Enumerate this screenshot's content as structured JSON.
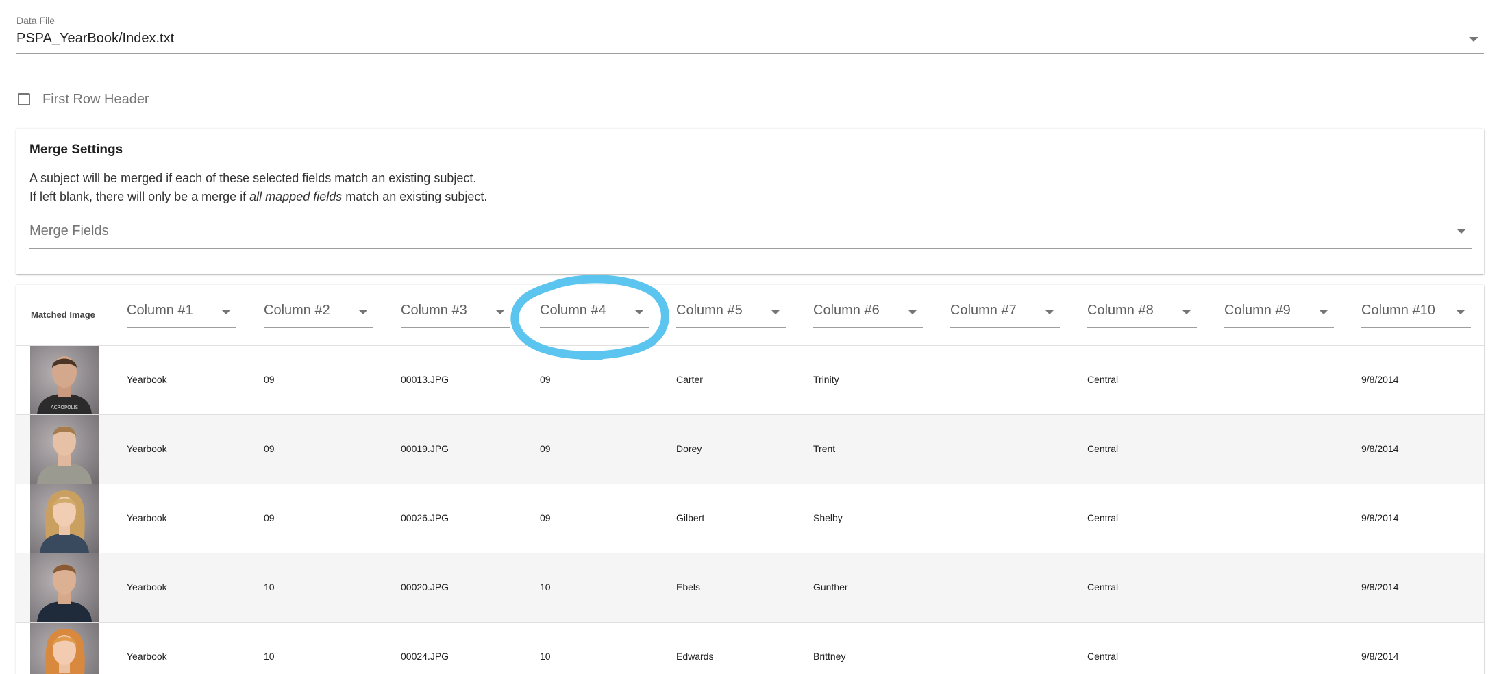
{
  "data_file": {
    "label": "Data File",
    "value": "PSPA_YearBook/Index.txt"
  },
  "first_row_header": {
    "label": "First Row Header",
    "checked": false
  },
  "merge_settings": {
    "title": "Merge Settings",
    "line1": "A subject will be merged if each of these selected fields match an existing subject.",
    "line2_pre": "If left blank, there will only be a merge if ",
    "line2_em": "all mapped fields",
    "line2_post": " match an existing subject.",
    "merge_fields_placeholder": "Merge Fields"
  },
  "table": {
    "matched_image_header": "Matched Image",
    "columns": [
      "Column #1",
      "Column #2",
      "Column #3",
      "Column #4",
      "Column #5",
      "Column #6",
      "Column #7",
      "Column #8",
      "Column #9",
      "Column #10"
    ],
    "rows": [
      {
        "photo": "student-photo-boy-1",
        "cells": [
          "Yearbook",
          "09",
          "00013.JPG",
          "09",
          "Carter",
          "Trinity",
          "",
          "Central",
          "",
          "9/8/2014"
        ]
      },
      {
        "photo": "student-photo-boy-2",
        "cells": [
          "Yearbook",
          "09",
          "00019.JPG",
          "09",
          "Dorey",
          "Trent",
          "",
          "Central",
          "",
          "9/8/2014"
        ]
      },
      {
        "photo": "student-photo-girl-1",
        "cells": [
          "Yearbook",
          "09",
          "00026.JPG",
          "09",
          "Gilbert",
          "Shelby",
          "",
          "Central",
          "",
          "9/8/2014"
        ]
      },
      {
        "photo": "student-photo-boy-3",
        "cells": [
          "Yearbook",
          "10",
          "00020.JPG",
          "10",
          "Ebels",
          "Gunther",
          "",
          "Central",
          "",
          "9/8/2014"
        ]
      },
      {
        "photo": "student-photo-girl-2",
        "cells": [
          "Yearbook",
          "10",
          "00024.JPG",
          "10",
          "Edwards",
          "Brittney",
          "",
          "Central",
          "",
          "9/8/2014"
        ]
      }
    ]
  },
  "annotation": {
    "highlight_color": "#5bc4ef",
    "highlight_target": "Column #4"
  },
  "colors": {
    "alt_row": "#f5f5f5",
    "divider": "#e0e0e0",
    "muted_text": "#757575"
  }
}
